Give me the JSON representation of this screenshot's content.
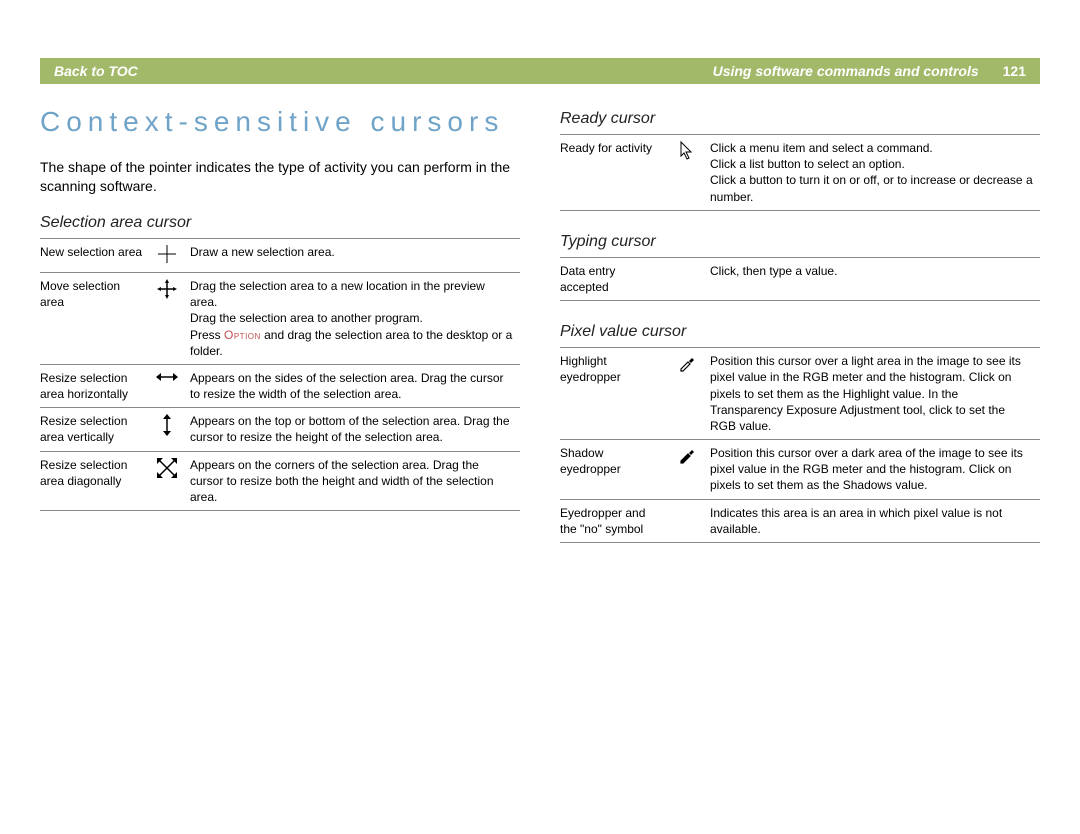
{
  "header": {
    "back": "Back to TOC",
    "chapter": "Using software commands and controls",
    "page": "121"
  },
  "title": "Context-sensitive cursors",
  "intro": "The shape of the pointer indicates the type of activity you can perform in the scanning software.",
  "left": {
    "section1": {
      "heading": "Selection area cursor",
      "rows": [
        {
          "label": "New selection area",
          "icon": "crosshair-icon",
          "desc": "Draw a new selection area."
        },
        {
          "label": "Move selection area",
          "icon": "move-icon",
          "desc_pre": "Drag the selection area to a new location in the preview area.\nDrag the selection area to another program.\nPress ",
          "option": "Option",
          "desc_post": " and drag the selection area to the desktop or a folder."
        },
        {
          "label": "Resize selection area horizontally",
          "icon": "resize-h-icon",
          "desc": "Appears on the sides of the selection area. Drag the cursor to resize the width of the selection area."
        },
        {
          "label": "Resize selection area vertically",
          "icon": "resize-v-icon",
          "desc": "Appears on the top or bottom of the selection area. Drag the cursor to resize the height of the selection area."
        },
        {
          "label": "Resize selection area diagonally",
          "icon": "resize-d-icon",
          "desc": "Appears on the corners of the selection area. Drag the cursor to resize both the height and width of the selection area."
        }
      ]
    }
  },
  "right": {
    "section1": {
      "heading": "Ready cursor",
      "rows": [
        {
          "label": "Ready for activity",
          "icon": "arrow-cursor-icon",
          "desc": "Click a menu item and select a command.\nClick a list button to select an option.\nClick a button to turn it on or off, or to increase or decrease a number."
        }
      ]
    },
    "section2": {
      "heading": "Typing cursor",
      "rows": [
        {
          "label": "Data entry accepted",
          "icon": "",
          "desc": "Click, then type a value."
        }
      ]
    },
    "section3": {
      "heading": "Pixel value cursor",
      "rows": [
        {
          "label": "Highlight eyedropper",
          "icon": "eyedropper-icon",
          "desc": "Position this cursor over a light area in the image to see its pixel value in the RGB meter and the histogram. Click on pixels to set them as the Highlight value. In the Transparency Exposure Adjustment tool, click to set the RGB value."
        },
        {
          "label": "Shadow eyedropper",
          "icon": "eyedropper-filled-icon",
          "desc": "Position this cursor over a dark area of the image to see its pixel value in the RGB meter and the histogram. Click on pixels to set them as the Shadows value."
        },
        {
          "label": "Eyedropper and the \"no\" symbol",
          "icon": "",
          "desc": "Indicates this area is an area in which pixel value is not available."
        }
      ]
    }
  }
}
